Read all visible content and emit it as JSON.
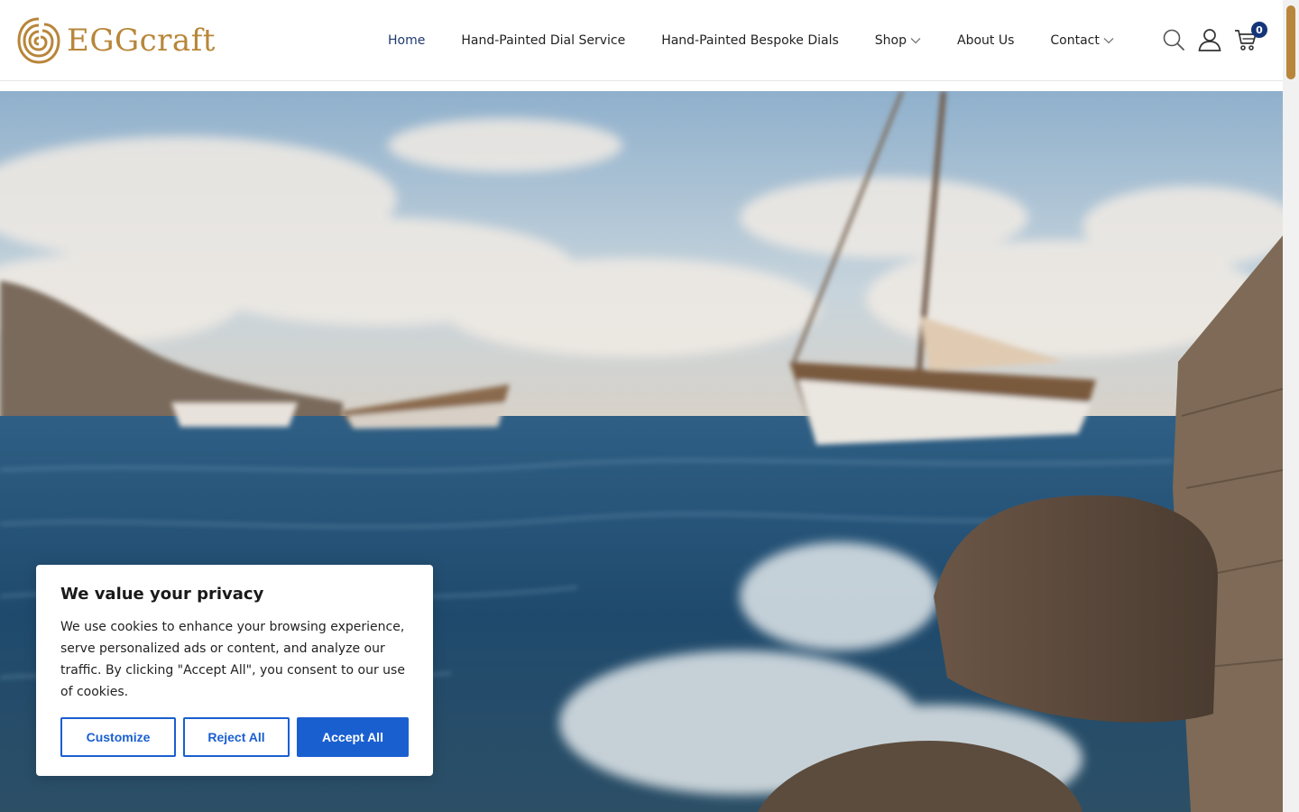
{
  "brand": {
    "name": "EGGcraft",
    "color": "#b8863a"
  },
  "nav": {
    "items": [
      {
        "label": "Home",
        "active": true,
        "has_dropdown": false
      },
      {
        "label": "Hand-Painted Dial Service",
        "active": false,
        "has_dropdown": false
      },
      {
        "label": "Hand-Painted Bespoke Dials",
        "active": false,
        "has_dropdown": false
      },
      {
        "label": "Shop",
        "active": false,
        "has_dropdown": true
      },
      {
        "label": "About Us",
        "active": false,
        "has_dropdown": false
      },
      {
        "label": "Contact",
        "active": false,
        "has_dropdown": true
      }
    ]
  },
  "header_icons": {
    "search": "search-icon",
    "account": "user-icon",
    "cart": "cart-icon",
    "cart_count": "0"
  },
  "hero": {
    "image": "blurred seascape with sailboats and rocky pier"
  },
  "cookie": {
    "title": "We value your privacy",
    "body": "We use cookies to enhance your browsing experience, serve personalized ads or content, and analyze our traffic. By clicking \"Accept All\", you consent to our use of cookies.",
    "customize_label": "Customize",
    "reject_label": "Reject All",
    "accept_label": "Accept All",
    "accent_color": "#1a5fd0"
  }
}
